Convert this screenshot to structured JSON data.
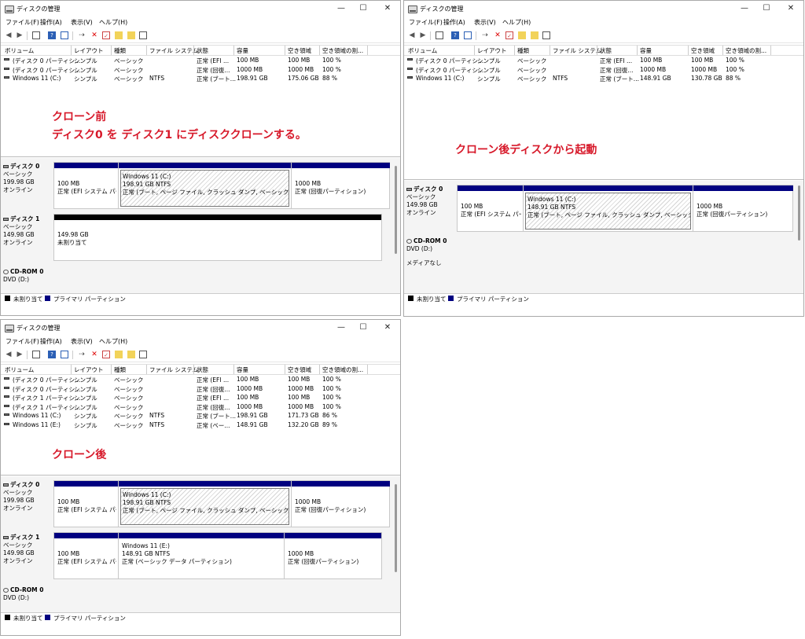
{
  "common": {
    "window_title": "ディスクの管理",
    "menus": [
      "ファイル(F)",
      "操作(A)",
      "表示(V)",
      "ヘルプ(H)"
    ],
    "columns": [
      "ボリューム",
      "レイアウト",
      "種類",
      "ファイル システム",
      "状態",
      "容量",
      "空き領域",
      "空き領域の割..."
    ],
    "legend": {
      "unallocated": "未割り当て",
      "primary": "プライマリ パーティション"
    },
    "titlebar_buttons": {
      "minimize": "—",
      "maximize": "☐",
      "close": "✕"
    }
  },
  "before": {
    "rows": [
      [
        "(ディスク 0 パーティシ...",
        "シンプル",
        "ベーシック",
        "",
        "正常 (EFI ...",
        "100 MB",
        "100 MB",
        "100 %"
      ],
      [
        "(ディスク 0 パーティシ...",
        "シンプル",
        "ベーシック",
        "",
        "正常 (回復...",
        "1000 MB",
        "1000 MB",
        "100 %"
      ],
      [
        "Windows 11 (C:)",
        "シンプル",
        "ベーシック",
        "NTFS",
        "正常 (ブート...",
        "198.91 GB",
        "175.06 GB",
        "88 %"
      ]
    ],
    "note_line1": "クローン前",
    "note_line2": "ディスク0 を ディスク1 にディスククローンする。",
    "disks": [
      {
        "name": "ディスク 0",
        "type": "ベーシック",
        "size": "199.98 GB",
        "status": "オンライン",
        "parts": [
          {
            "l1": "100 MB",
            "l2": "正常 (EFI システム パー"
          },
          {
            "l0": "Windows 11  (C:)",
            "l1": "198.91 GB NTFS",
            "l2": "正常 (ブート, ページ ファイル, クラッシュ ダンプ, ベーシック データ パー"
          },
          {
            "l1": "1000 MB",
            "l2": "正常 (回復パーティション)"
          }
        ]
      },
      {
        "name": "ディスク 1",
        "type": "ベーシック",
        "size": "149.98 GB",
        "status": "オンライン",
        "parts": [
          {
            "l1": "149.98 GB",
            "l2": "未割り当て"
          }
        ]
      }
    ],
    "cdrom": {
      "name": "CD-ROM 0",
      "drive": "DVD (D:)"
    }
  },
  "booted": {
    "rows": [
      [
        "(ディスク 0 パーティシ...",
        "シンプル",
        "ベーシック",
        "",
        "正常 (EFI ...",
        "100 MB",
        "100 MB",
        "100 %"
      ],
      [
        "(ディスク 0 パーティシ...",
        "シンプル",
        "ベーシック",
        "",
        "正常 (回復...",
        "1000 MB",
        "1000 MB",
        "100 %"
      ],
      [
        "Windows 11 (C:)",
        "シンプル",
        "ベーシック",
        "NTFS",
        "正常 (ブート...",
        "148.91 GB",
        "130.78 GB",
        "88 %"
      ]
    ],
    "note": "クローン後ディスクから起動",
    "disks": [
      {
        "name": "ディスク 0",
        "type": "ベーシック",
        "size": "149.98 GB",
        "status": "オンライン",
        "parts": [
          {
            "l1": "100 MB",
            "l2": "正常 (EFI システム パー"
          },
          {
            "l0": "Windows 11  (C:)",
            "l1": "148.91 GB NTFS",
            "l2": "正常 (ブート, ページ ファイル, クラッシュ ダンプ, ベーシック データ パー"
          },
          {
            "l1": "1000 MB",
            "l2": "正常 (回復パーティション)"
          }
        ]
      }
    ],
    "cdrom": {
      "name": "CD-ROM 0",
      "drive": "DVD (D:)",
      "media": "メディアなし"
    }
  },
  "after": {
    "rows": [
      [
        "(ディスク 0 パーティシ...",
        "シンプル",
        "ベーシック",
        "",
        "正常 (EFI ...",
        "100 MB",
        "100 MB",
        "100 %"
      ],
      [
        "(ディスク 0 パーティシ...",
        "シンプル",
        "ベーシック",
        "",
        "正常 (回復...",
        "1000 MB",
        "1000 MB",
        "100 %"
      ],
      [
        "(ディスク 1 パーティシ...",
        "シンプル",
        "ベーシック",
        "",
        "正常 (EFI ...",
        "100 MB",
        "100 MB",
        "100 %"
      ],
      [
        "(ディスク 1 パーティシ...",
        "シンプル",
        "ベーシック",
        "",
        "正常 (回復...",
        "1000 MB",
        "1000 MB",
        "100 %"
      ],
      [
        "Windows 11 (C:)",
        "シンプル",
        "ベーシック",
        "NTFS",
        "正常 (ブート...",
        "198.91 GB",
        "171.73 GB",
        "86 %"
      ],
      [
        "Windows 11 (E:)",
        "シンプル",
        "ベーシック",
        "NTFS",
        "正常 (ベー...",
        "148.91 GB",
        "132.20 GB",
        "89 %"
      ]
    ],
    "note": "クローン後",
    "disks": [
      {
        "name": "ディスク 0",
        "type": "ベーシック",
        "size": "199.98 GB",
        "status": "オンライン",
        "parts": [
          {
            "l1": "100 MB",
            "l2": "正常 (EFI システム パー"
          },
          {
            "l0": "Windows 11  (C:)",
            "l1": "198.91 GB NTFS",
            "l2": "正常 (ブート, ページ ファイル, クラッシュ ダンプ, ベーシック データ パー"
          },
          {
            "l1": "1000 MB",
            "l2": "正常 (回復パーティション)"
          }
        ]
      },
      {
        "name": "ディスク 1",
        "type": "ベーシック",
        "size": "149.98 GB",
        "status": "オンライン",
        "parts": [
          {
            "l1": "100 MB",
            "l2": "正常 (EFI システム パー"
          },
          {
            "l0": "Windows 11  (E:)",
            "l1": "148.91 GB NTFS",
            "l2": "正常 (ベーシック データ パーティション)"
          },
          {
            "l1": "1000 MB",
            "l2": "正常 (回復パーティション)"
          }
        ]
      }
    ],
    "cdrom": {
      "name": "CD-ROM 0",
      "drive": "DVD (D:)"
    }
  }
}
